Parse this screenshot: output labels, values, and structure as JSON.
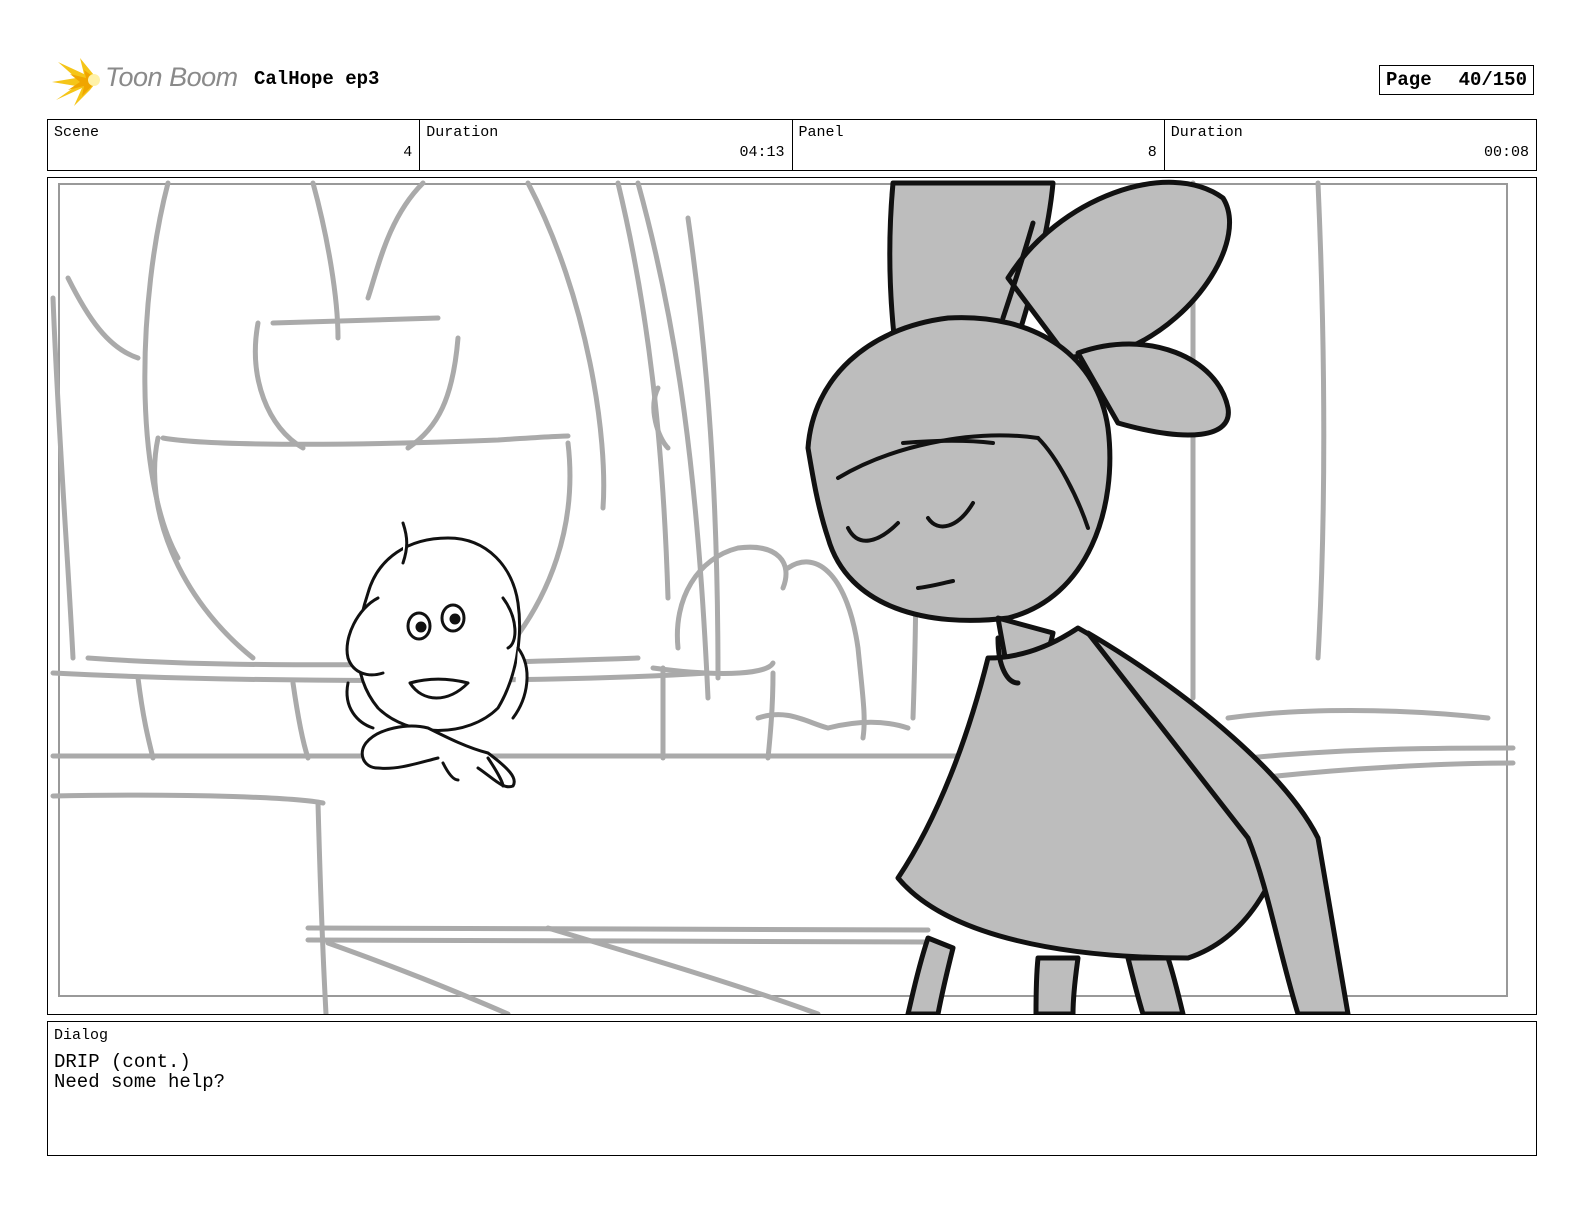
{
  "header": {
    "logo_text": "Toon Boom",
    "project_title": "CalHope ep3",
    "page_label": "Page",
    "page_number": "40/150"
  },
  "info": {
    "scene_label": "Scene",
    "scene_value": "4",
    "scene_duration_label": "Duration",
    "scene_duration_value": "04:13",
    "panel_label": "Panel",
    "panel_value": "8",
    "panel_duration_label": "Duration",
    "panel_duration_value": "00:08"
  },
  "dialog": {
    "label": "Dialog",
    "speaker": "DRIP (cont.)",
    "line": "Need some help?"
  },
  "colors": {
    "sketch_gray": "#aaaaaa",
    "character_fill": "#bdbdbd",
    "logo_star": "#f5c518"
  }
}
